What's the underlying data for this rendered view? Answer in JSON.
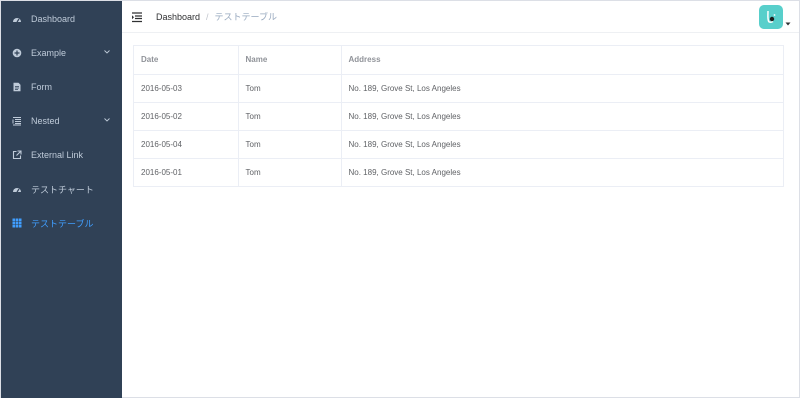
{
  "sidebar": {
    "items": [
      {
        "label": "Dashboard",
        "icon": "dashboard-icon"
      },
      {
        "label": "Example",
        "icon": "example-icon",
        "has_submenu": true
      },
      {
        "label": "Form",
        "icon": "form-icon"
      },
      {
        "label": "Nested",
        "icon": "nested-icon",
        "has_submenu": true
      },
      {
        "label": "External Link",
        "icon": "external-link-icon"
      },
      {
        "label": "テストチャート",
        "icon": "dashboard-icon"
      },
      {
        "label": "テストテーブル",
        "icon": "table-icon",
        "active": true
      }
    ]
  },
  "navbar": {
    "breadcrumb": {
      "first": "Dashboard",
      "separator": "/",
      "current": "テストテーブル"
    }
  },
  "table": {
    "columns": [
      "Date",
      "Name",
      "Address"
    ],
    "rows": [
      [
        "2016-05-03",
        "Tom",
        "No. 189, Grove St, Los Angeles"
      ],
      [
        "2016-05-02",
        "Tom",
        "No. 189, Grove St, Los Angeles"
      ],
      [
        "2016-05-04",
        "Tom",
        "No. 189, Grove St, Los Angeles"
      ],
      [
        "2016-05-01",
        "Tom",
        "No. 189, Grove St, Los Angeles"
      ]
    ]
  },
  "colors": {
    "sidebar_bg": "#304156",
    "sidebar_text": "#bfcbd9",
    "active": "#409eff",
    "avatar_bg": "#58cfcb"
  }
}
